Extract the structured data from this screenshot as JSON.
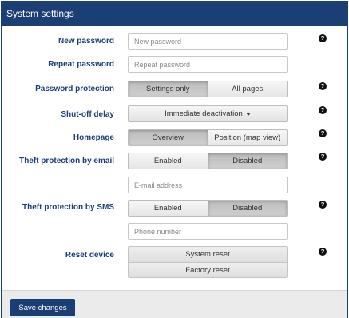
{
  "header": {
    "title": "System settings"
  },
  "fields": {
    "new_password": {
      "label": "New password",
      "placeholder": "New password"
    },
    "repeat_password": {
      "label": "Repeat password",
      "placeholder": "Repeat password"
    },
    "password_protection": {
      "label": "Password protection",
      "options": [
        "Settings only",
        "All pages"
      ],
      "selected": "Settings only"
    },
    "shutoff_delay": {
      "label": "Shut-off delay",
      "value": "Immediate deactivation"
    },
    "homepage": {
      "label": "Homepage",
      "options": [
        "Overview",
        "Position (map view)"
      ],
      "selected": "Overview"
    },
    "theft_email": {
      "label": "Theft protection by email",
      "options": [
        "Enabled",
        "Disabled"
      ],
      "selected": "Disabled",
      "placeholder": "E-mail address"
    },
    "theft_sms": {
      "label": "Theft protection by SMS",
      "options": [
        "Enabled",
        "Disabled"
      ],
      "selected": "Disabled",
      "placeholder": "Phone number"
    },
    "reset_device": {
      "label": "Reset device",
      "options": [
        "System reset",
        "Factory reset"
      ]
    }
  },
  "help_icon_glyph": "?",
  "footer": {
    "save_label": "Save changes"
  },
  "colors": {
    "brand": "#1b3f75",
    "label": "#1b3f75",
    "footer_bg": "#ebebeb",
    "selected_segment": "#c4c4c4"
  },
  "icons": {
    "help": "question-circle-icon",
    "dropdown": "caret-down-icon"
  }
}
